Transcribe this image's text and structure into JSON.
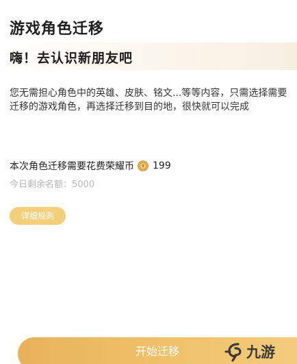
{
  "header": {
    "title": "游戏角色迁移"
  },
  "intro": {
    "greeting": "嗨！去认识新朋友吧",
    "description": "您无需担心角色中的英雄、皮肤、铭文...等等内容，只需选择需要迁移的游戏角色，再选择迁移到目的地，很快就可以完成"
  },
  "cost": {
    "label": "本次角色迁移需要花费荣耀币",
    "amount": "199",
    "coin_icon": "honor-coin-icon",
    "quota": "今日剩余名额：5000"
  },
  "actions": {
    "rules_label": "详细规则",
    "start_label": "开始迁移"
  },
  "watermark": {
    "text": "九游"
  },
  "colors": {
    "accent": "#efc069",
    "rules_button": "#f3cf7c",
    "muted_text": "#b5b5b5",
    "watermark": "#3a3a3a"
  }
}
